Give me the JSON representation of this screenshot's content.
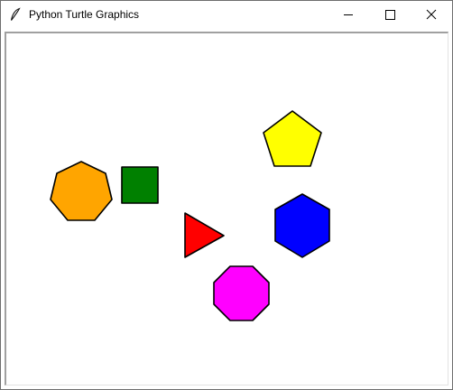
{
  "window": {
    "title": "Python Turtle Graphics",
    "icon": "feather-icon",
    "controls": [
      "minimize-icon",
      "maximize-icon",
      "close-icon"
    ]
  },
  "canvas": {
    "background": "#ffffff",
    "outline_color": "#000000",
    "shapes": [
      {
        "name": "heptagon",
        "sides": 7,
        "fill": "#ffa500"
      },
      {
        "name": "square",
        "sides": 4,
        "fill": "#008000"
      },
      {
        "name": "triangle",
        "sides": 3,
        "fill": "#ff0000"
      },
      {
        "name": "pentagon",
        "sides": 5,
        "fill": "#ffff00"
      },
      {
        "name": "hexagon",
        "sides": 6,
        "fill": "#0000ff"
      },
      {
        "name": "octagon",
        "sides": 8,
        "fill": "#ff00ff"
      }
    ]
  }
}
